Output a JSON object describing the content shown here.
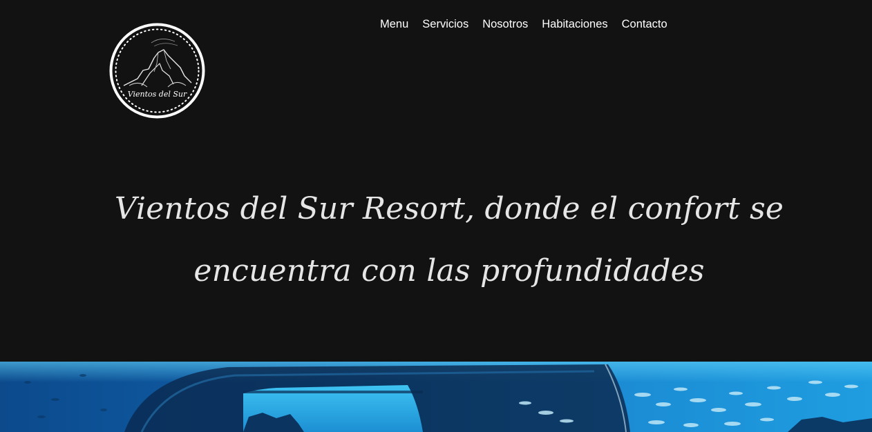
{
  "header": {
    "logo": {
      "text": "Vientos del Sur",
      "icon": "mountain-circle-logo-icon"
    },
    "nav": [
      {
        "label": "Menu"
      },
      {
        "label": "Servicios"
      },
      {
        "label": "Nosotros"
      },
      {
        "label": "Habitaciones"
      },
      {
        "label": "Contacto"
      }
    ]
  },
  "hero": {
    "title": "Vientos del Sur Resort, donde el confort se encuentra con las profundidades"
  },
  "banner": {
    "image": "underwater-dome-with-fish"
  },
  "colors": {
    "background": "#121212",
    "nav_text": "#ffffff",
    "hero_text": "#e6e6e6",
    "water_deep": "#0a3f7a",
    "water_light": "#2fb6ea"
  }
}
